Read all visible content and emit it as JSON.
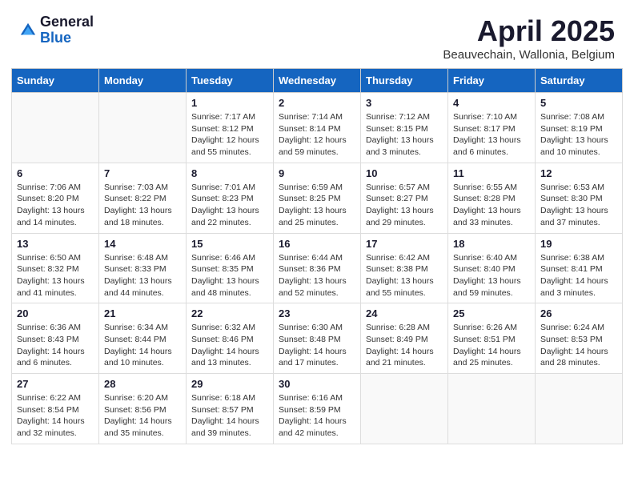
{
  "header": {
    "logo_general": "General",
    "logo_blue": "Blue",
    "title": "April 2025",
    "subtitle": "Beauvechain, Wallonia, Belgium"
  },
  "days_of_week": [
    "Sunday",
    "Monday",
    "Tuesday",
    "Wednesday",
    "Thursday",
    "Friday",
    "Saturday"
  ],
  "weeks": [
    [
      {
        "num": "",
        "detail": ""
      },
      {
        "num": "",
        "detail": ""
      },
      {
        "num": "1",
        "detail": "Sunrise: 7:17 AM\nSunset: 8:12 PM\nDaylight: 12 hours\nand 55 minutes."
      },
      {
        "num": "2",
        "detail": "Sunrise: 7:14 AM\nSunset: 8:14 PM\nDaylight: 12 hours\nand 59 minutes."
      },
      {
        "num": "3",
        "detail": "Sunrise: 7:12 AM\nSunset: 8:15 PM\nDaylight: 13 hours\nand 3 minutes."
      },
      {
        "num": "4",
        "detail": "Sunrise: 7:10 AM\nSunset: 8:17 PM\nDaylight: 13 hours\nand 6 minutes."
      },
      {
        "num": "5",
        "detail": "Sunrise: 7:08 AM\nSunset: 8:19 PM\nDaylight: 13 hours\nand 10 minutes."
      }
    ],
    [
      {
        "num": "6",
        "detail": "Sunrise: 7:06 AM\nSunset: 8:20 PM\nDaylight: 13 hours\nand 14 minutes."
      },
      {
        "num": "7",
        "detail": "Sunrise: 7:03 AM\nSunset: 8:22 PM\nDaylight: 13 hours\nand 18 minutes."
      },
      {
        "num": "8",
        "detail": "Sunrise: 7:01 AM\nSunset: 8:23 PM\nDaylight: 13 hours\nand 22 minutes."
      },
      {
        "num": "9",
        "detail": "Sunrise: 6:59 AM\nSunset: 8:25 PM\nDaylight: 13 hours\nand 25 minutes."
      },
      {
        "num": "10",
        "detail": "Sunrise: 6:57 AM\nSunset: 8:27 PM\nDaylight: 13 hours\nand 29 minutes."
      },
      {
        "num": "11",
        "detail": "Sunrise: 6:55 AM\nSunset: 8:28 PM\nDaylight: 13 hours\nand 33 minutes."
      },
      {
        "num": "12",
        "detail": "Sunrise: 6:53 AM\nSunset: 8:30 PM\nDaylight: 13 hours\nand 37 minutes."
      }
    ],
    [
      {
        "num": "13",
        "detail": "Sunrise: 6:50 AM\nSunset: 8:32 PM\nDaylight: 13 hours\nand 41 minutes."
      },
      {
        "num": "14",
        "detail": "Sunrise: 6:48 AM\nSunset: 8:33 PM\nDaylight: 13 hours\nand 44 minutes."
      },
      {
        "num": "15",
        "detail": "Sunrise: 6:46 AM\nSunset: 8:35 PM\nDaylight: 13 hours\nand 48 minutes."
      },
      {
        "num": "16",
        "detail": "Sunrise: 6:44 AM\nSunset: 8:36 PM\nDaylight: 13 hours\nand 52 minutes."
      },
      {
        "num": "17",
        "detail": "Sunrise: 6:42 AM\nSunset: 8:38 PM\nDaylight: 13 hours\nand 55 minutes."
      },
      {
        "num": "18",
        "detail": "Sunrise: 6:40 AM\nSunset: 8:40 PM\nDaylight: 13 hours\nand 59 minutes."
      },
      {
        "num": "19",
        "detail": "Sunrise: 6:38 AM\nSunset: 8:41 PM\nDaylight: 14 hours\nand 3 minutes."
      }
    ],
    [
      {
        "num": "20",
        "detail": "Sunrise: 6:36 AM\nSunset: 8:43 PM\nDaylight: 14 hours\nand 6 minutes."
      },
      {
        "num": "21",
        "detail": "Sunrise: 6:34 AM\nSunset: 8:44 PM\nDaylight: 14 hours\nand 10 minutes."
      },
      {
        "num": "22",
        "detail": "Sunrise: 6:32 AM\nSunset: 8:46 PM\nDaylight: 14 hours\nand 13 minutes."
      },
      {
        "num": "23",
        "detail": "Sunrise: 6:30 AM\nSunset: 8:48 PM\nDaylight: 14 hours\nand 17 minutes."
      },
      {
        "num": "24",
        "detail": "Sunrise: 6:28 AM\nSunset: 8:49 PM\nDaylight: 14 hours\nand 21 minutes."
      },
      {
        "num": "25",
        "detail": "Sunrise: 6:26 AM\nSunset: 8:51 PM\nDaylight: 14 hours\nand 25 minutes."
      },
      {
        "num": "26",
        "detail": "Sunrise: 6:24 AM\nSunset: 8:53 PM\nDaylight: 14 hours\nand 28 minutes."
      }
    ],
    [
      {
        "num": "27",
        "detail": "Sunrise: 6:22 AM\nSunset: 8:54 PM\nDaylight: 14 hours\nand 32 minutes."
      },
      {
        "num": "28",
        "detail": "Sunrise: 6:20 AM\nSunset: 8:56 PM\nDaylight: 14 hours\nand 35 minutes."
      },
      {
        "num": "29",
        "detail": "Sunrise: 6:18 AM\nSunset: 8:57 PM\nDaylight: 14 hours\nand 39 minutes."
      },
      {
        "num": "30",
        "detail": "Sunrise: 6:16 AM\nSunset: 8:59 PM\nDaylight: 14 hours\nand 42 minutes."
      },
      {
        "num": "",
        "detail": ""
      },
      {
        "num": "",
        "detail": ""
      },
      {
        "num": "",
        "detail": ""
      }
    ]
  ]
}
